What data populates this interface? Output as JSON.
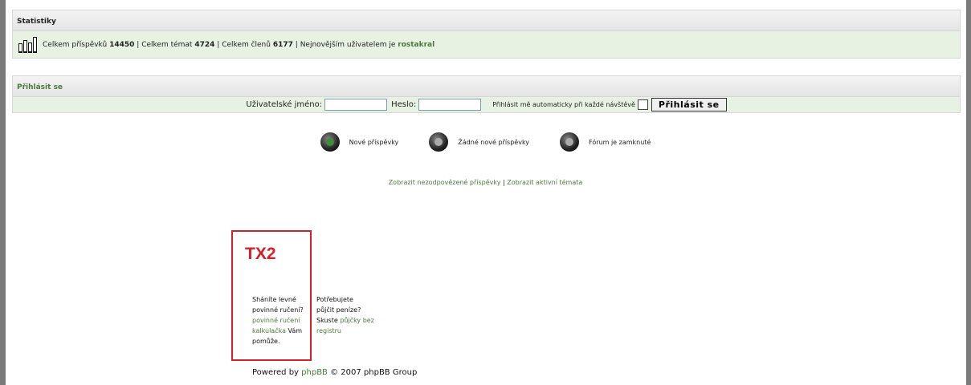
{
  "stats": {
    "title": "Statistiky",
    "posts_label": "Celkem příspěvků",
    "posts_count": "14450",
    "topics_label": "Celkem témat",
    "topics_count": "4724",
    "members_label": "Celkem členů",
    "members_count": "6177",
    "newest_label": "Nejnovějším uživatelem je",
    "newest_user": "rostakral",
    "separator": "|"
  },
  "login": {
    "title": "Přihlásit se",
    "username_label": "Uživatelské jméno:",
    "username_value": "",
    "password_label": "Heslo:",
    "password_value": "",
    "autologin_label": "Přihlásit mě automaticky při každé návštěvě",
    "submit_label": "Přihlásit se"
  },
  "legend": {
    "new_posts": "Nové příspěvky",
    "no_new_posts": "Žádné nové příspěvky",
    "locked": "Fórum je zamknuté",
    "icon_colors": {
      "new": "#3e8d3a",
      "none": "#aaaaaa"
    }
  },
  "links": {
    "unanswered": "Zobrazit nezodpovězené příspěvky",
    "separator": "|",
    "active": "Zobrazit aktivní témata"
  },
  "ad": {
    "title": "TX2",
    "col1_l1": "Sháníte levné",
    "col1_l2": "povinné ručení?",
    "col1_link_l1": "povinné ručení",
    "col1_link_l2": "kalkulačka",
    "col1_text_after": "Vám",
    "col1_l5": "pomůže.",
    "col2_l1": "Potřebujete",
    "col2_l2": "půjčit peníze?",
    "col2_text_before": "Skuste",
    "col2_link_l1": "půjčky bez",
    "col2_link_l2": "registru",
    "border_color": "#d3202a"
  },
  "footer": {
    "powered_prefix": "Powered by",
    "powered_link": "phpBB",
    "powered_suffix": "© 2007 phpBB Group"
  },
  "colors": {
    "accent_green": "#4a7a3a",
    "row_bg": "#e7f2e3"
  }
}
